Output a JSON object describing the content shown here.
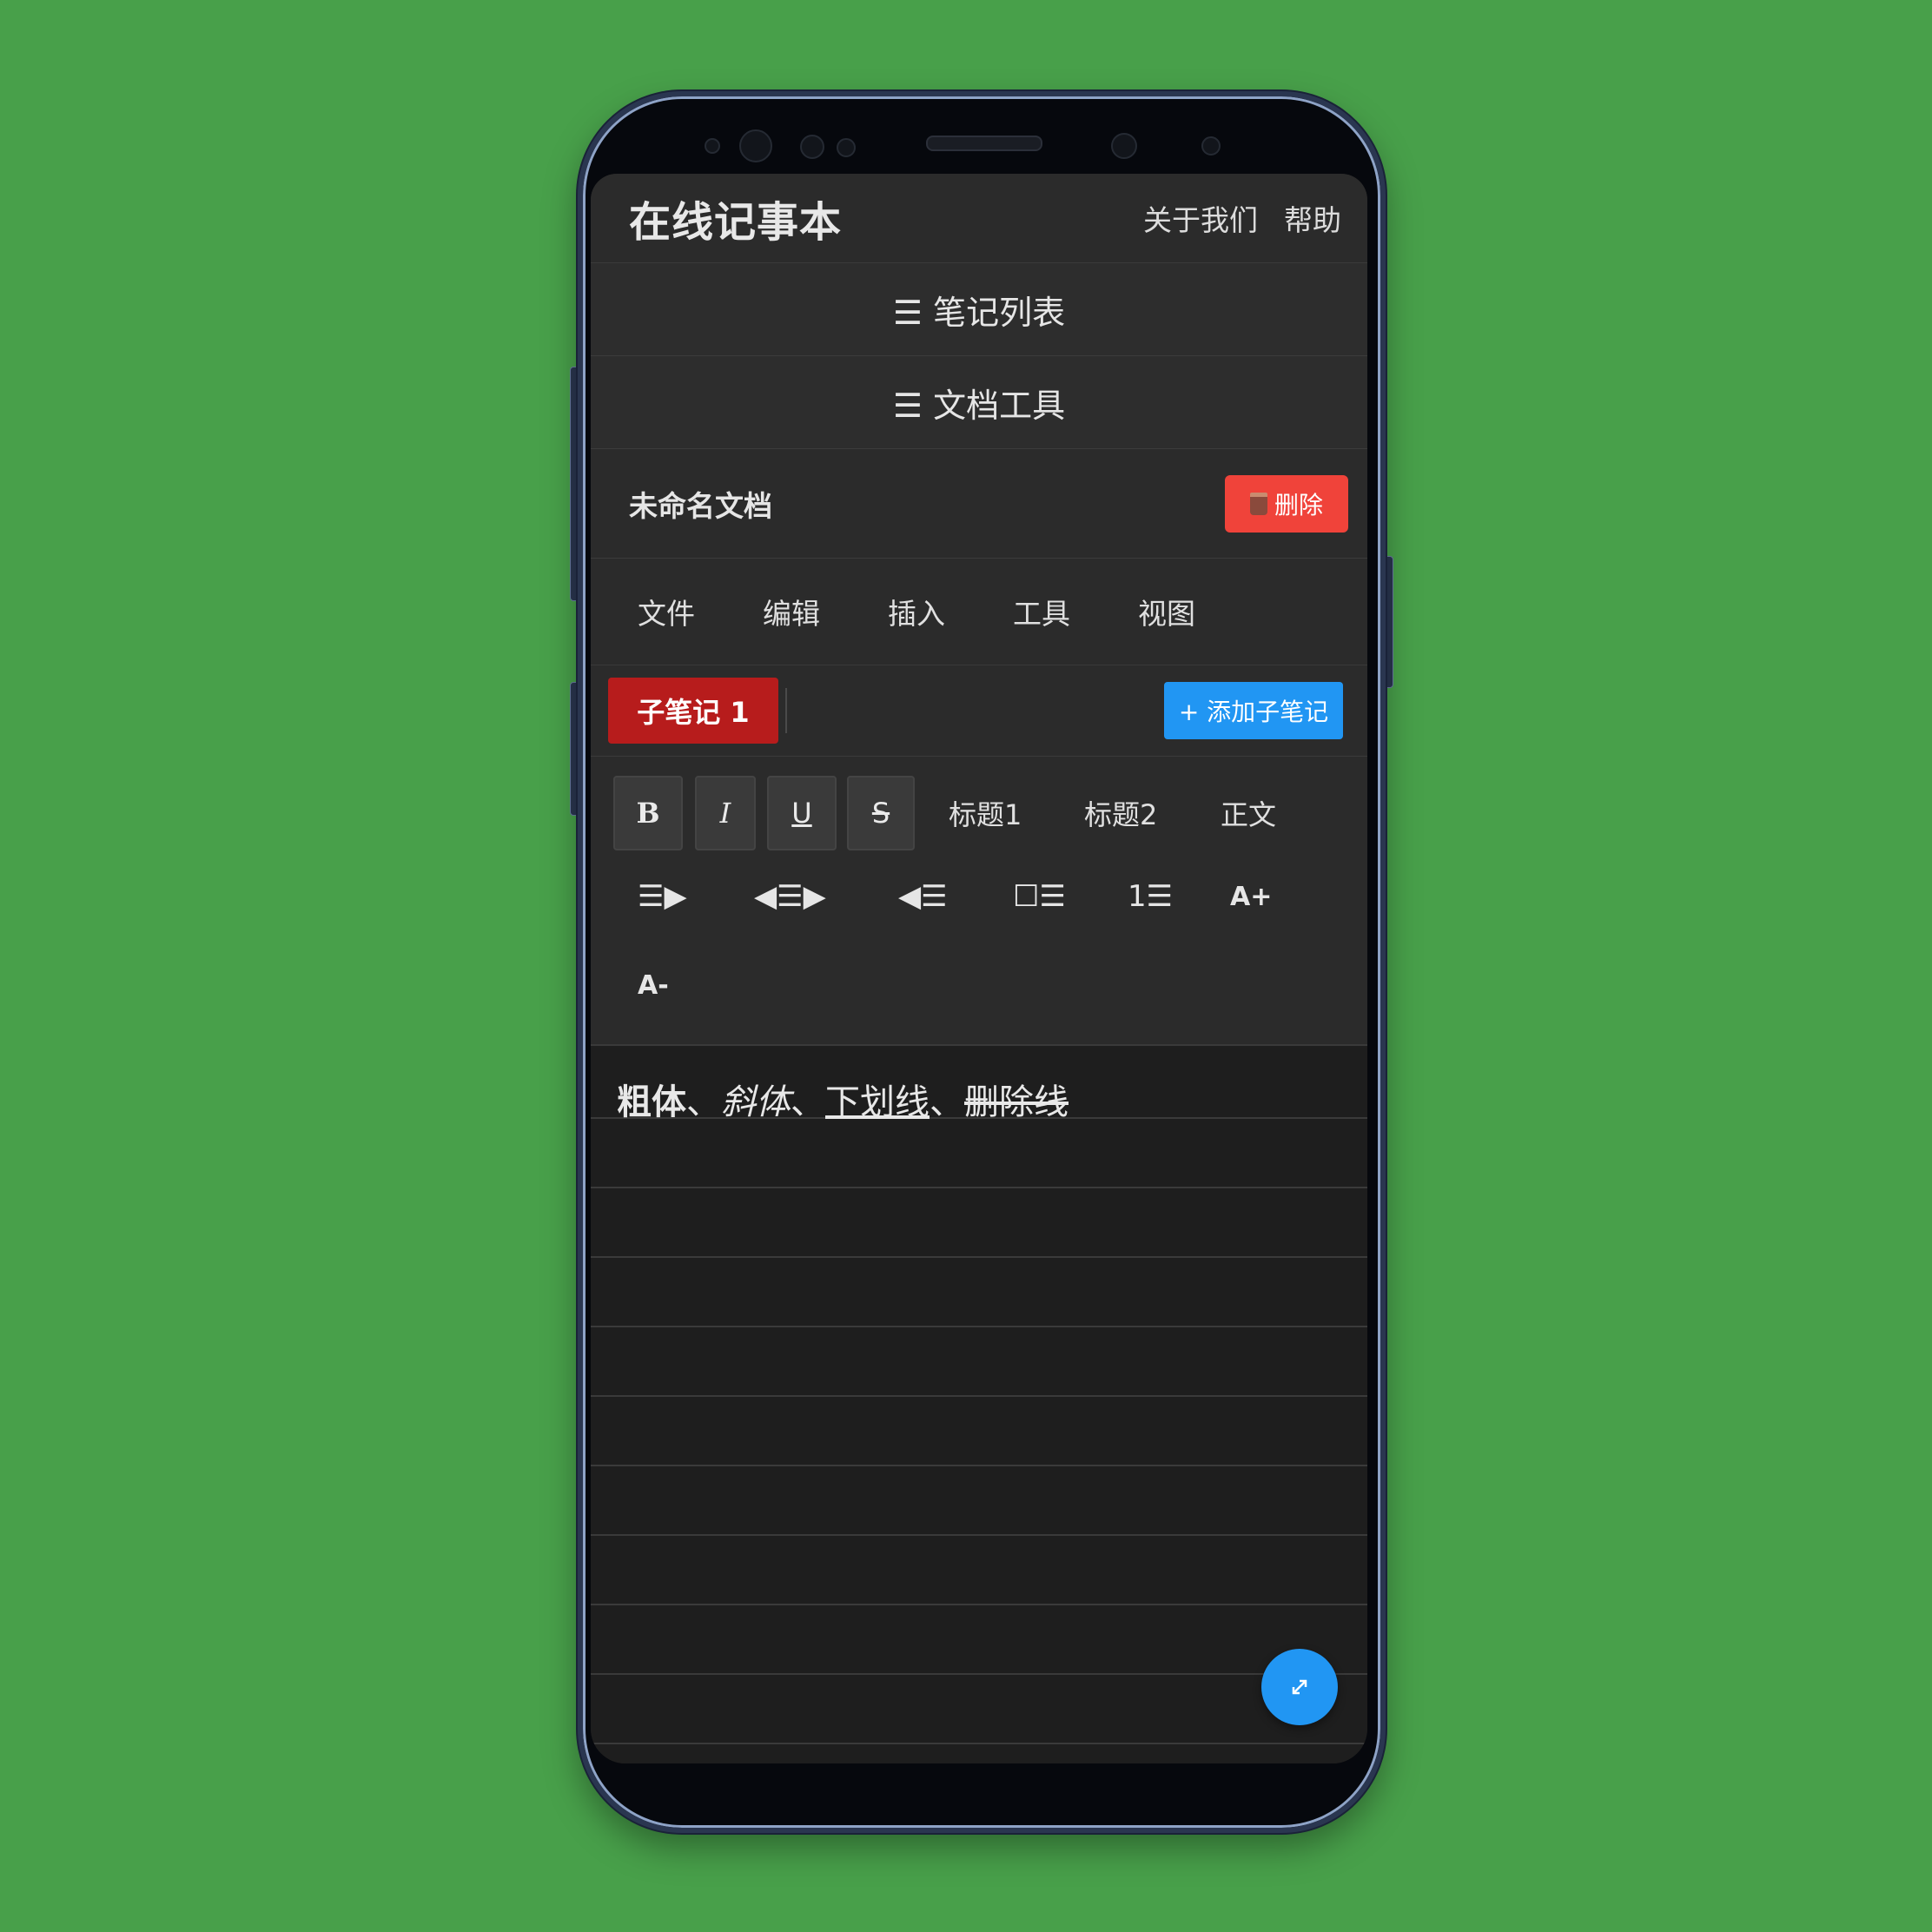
{
  "app": {
    "title": "在线记事本",
    "links": [
      "关于我们",
      "帮助"
    ]
  },
  "panels": {
    "notes_list": "☰ 笔记列表",
    "doc_tools": "☰ 文档工具"
  },
  "document": {
    "name": "未命名文档",
    "delete_label": "删除",
    "delete_icon": "trash-icon"
  },
  "menubar": [
    "文件",
    "编辑",
    "插入",
    "工具",
    "视图"
  ],
  "subnotes": {
    "active_tab": "子笔记 1",
    "add_label": "+ 添加子笔记"
  },
  "toolbar": {
    "format": {
      "bold": "B",
      "italic": "I",
      "underline": "U",
      "strike": "S"
    },
    "styles": {
      "h1": "标题1",
      "h2": "标题2",
      "body": "正文"
    },
    "row2": {
      "align_right": "☰▶",
      "align_center": "◀☰▶",
      "align_left": "◀☰",
      "checklist": "☐☰",
      "ordered_list": "1☰",
      "font_inc": "A+"
    },
    "font_dec": "A-"
  },
  "editor": {
    "bold_text": "粗体",
    "sep1": "、",
    "italic_text": "斜体",
    "sep2": "、",
    "underline_text": "下划线",
    "sep3": "、",
    "strike_text": "删除线"
  },
  "fab": {
    "icon": "expand-icon"
  },
  "colors": {
    "background": "#48a04a",
    "delete": "#f0433a",
    "tab_active": "#b71c1c",
    "accent": "#2196f3"
  }
}
